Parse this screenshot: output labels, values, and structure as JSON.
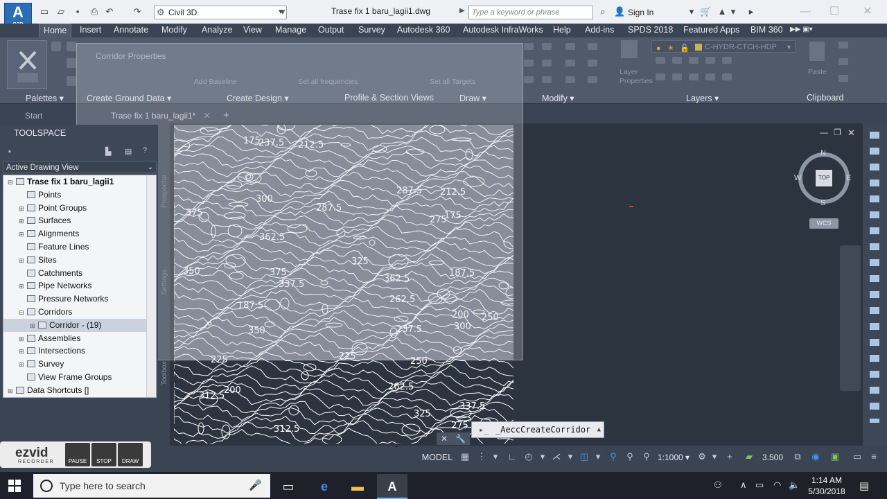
{
  "app": {
    "logo_text": "A",
    "logo_sub": "C3D",
    "workspace": "Civil 3D",
    "document_title": "Trase fix 1 baru_lagii1.dwg",
    "search_placeholder": "Type a keyword or phrase",
    "sign_in": "Sign In"
  },
  "ribbon": {
    "tabs": [
      "Home",
      "Insert",
      "Annotate",
      "Modify",
      "Analyze",
      "View",
      "Manage",
      "Output",
      "Survey",
      "Autodesk 360",
      "Autodesk InfraWorks",
      "Help",
      "Add-ins",
      "SPDS 2018",
      "Featured Apps",
      "BIM 360"
    ],
    "active_tab": "Home",
    "panels": [
      "Palettes",
      "Create Ground Data",
      "Create Design",
      "Profile & Section Views",
      "Draw",
      "Modify",
      "Layers",
      "Clipboard"
    ],
    "layer_name": "C-HYDR-CTCH-HDP",
    "layer_properties": "Layer Properties",
    "paste": "Paste"
  },
  "dialog": {
    "title": "Corridor Properties",
    "add_baseline": "Add Baseline",
    "set_all_frequencies": "Set all frequencies",
    "set_all_targets": "Set all Targets"
  },
  "file_tabs": [
    "Start",
    "Trase fix 1 baru_lagii1*"
  ],
  "toolspace": {
    "title": "TOOLSPACE",
    "view": "Active Drawing View",
    "side_tabs": [
      "Prospector",
      "Settings",
      "Toolbox"
    ],
    "tree": [
      {
        "label": "Trase fix 1 baru_lagii1",
        "level": 0,
        "bold": true,
        "expander": "−"
      },
      {
        "label": "Points",
        "level": 1,
        "expander": ""
      },
      {
        "label": "Point Groups",
        "level": 1,
        "expander": "+"
      },
      {
        "label": "Surfaces",
        "level": 1,
        "expander": "+"
      },
      {
        "label": "Alignments",
        "level": 1,
        "expander": "+"
      },
      {
        "label": "Feature Lines",
        "level": 1,
        "expander": ""
      },
      {
        "label": "Sites",
        "level": 1,
        "expander": "+"
      },
      {
        "label": "Catchments",
        "level": 1,
        "expander": ""
      },
      {
        "label": "Pipe Networks",
        "level": 1,
        "expander": "+"
      },
      {
        "label": "Pressure Networks",
        "level": 1,
        "expander": ""
      },
      {
        "label": "Corridors",
        "level": 1,
        "expander": "−"
      },
      {
        "label": "Corridor - (19)",
        "level": 2,
        "expander": "+",
        "selected": true
      },
      {
        "label": "Assemblies",
        "level": 1,
        "expander": "+"
      },
      {
        "label": "Intersections",
        "level": 1,
        "expander": "+"
      },
      {
        "label": "Survey",
        "level": 1,
        "expander": "+"
      },
      {
        "label": "View Frame Groups",
        "level": 1,
        "expander": ""
      },
      {
        "label": "Data Shortcuts []",
        "level": 0,
        "expander": "+"
      }
    ]
  },
  "viewcube": {
    "n": "N",
    "s": "S",
    "e": "E",
    "w": "W",
    "top": "TOP",
    "wcs": "WCS"
  },
  "contour_labels": [
    "250",
    "262.5",
    "275",
    "287.5",
    "300",
    "312.5",
    "325",
    "337.5",
    "350",
    "362.5",
    "375",
    "237.5",
    "225",
    "200",
    "212.5",
    "187.5",
    "175"
  ],
  "command_line": "_AeccCreateCorridor",
  "status": {
    "model": "MODEL",
    "scale": "1:1000",
    "lineweight": "3.500"
  },
  "ezvid": {
    "brand": "ezvid",
    "sub": "RECORDER",
    "buttons": [
      "PAUSE",
      "STOP",
      "DRAW"
    ]
  },
  "taskbar": {
    "search_placeholder": "Type here to search",
    "time": "1:14 AM",
    "date": "5/30/2018"
  }
}
